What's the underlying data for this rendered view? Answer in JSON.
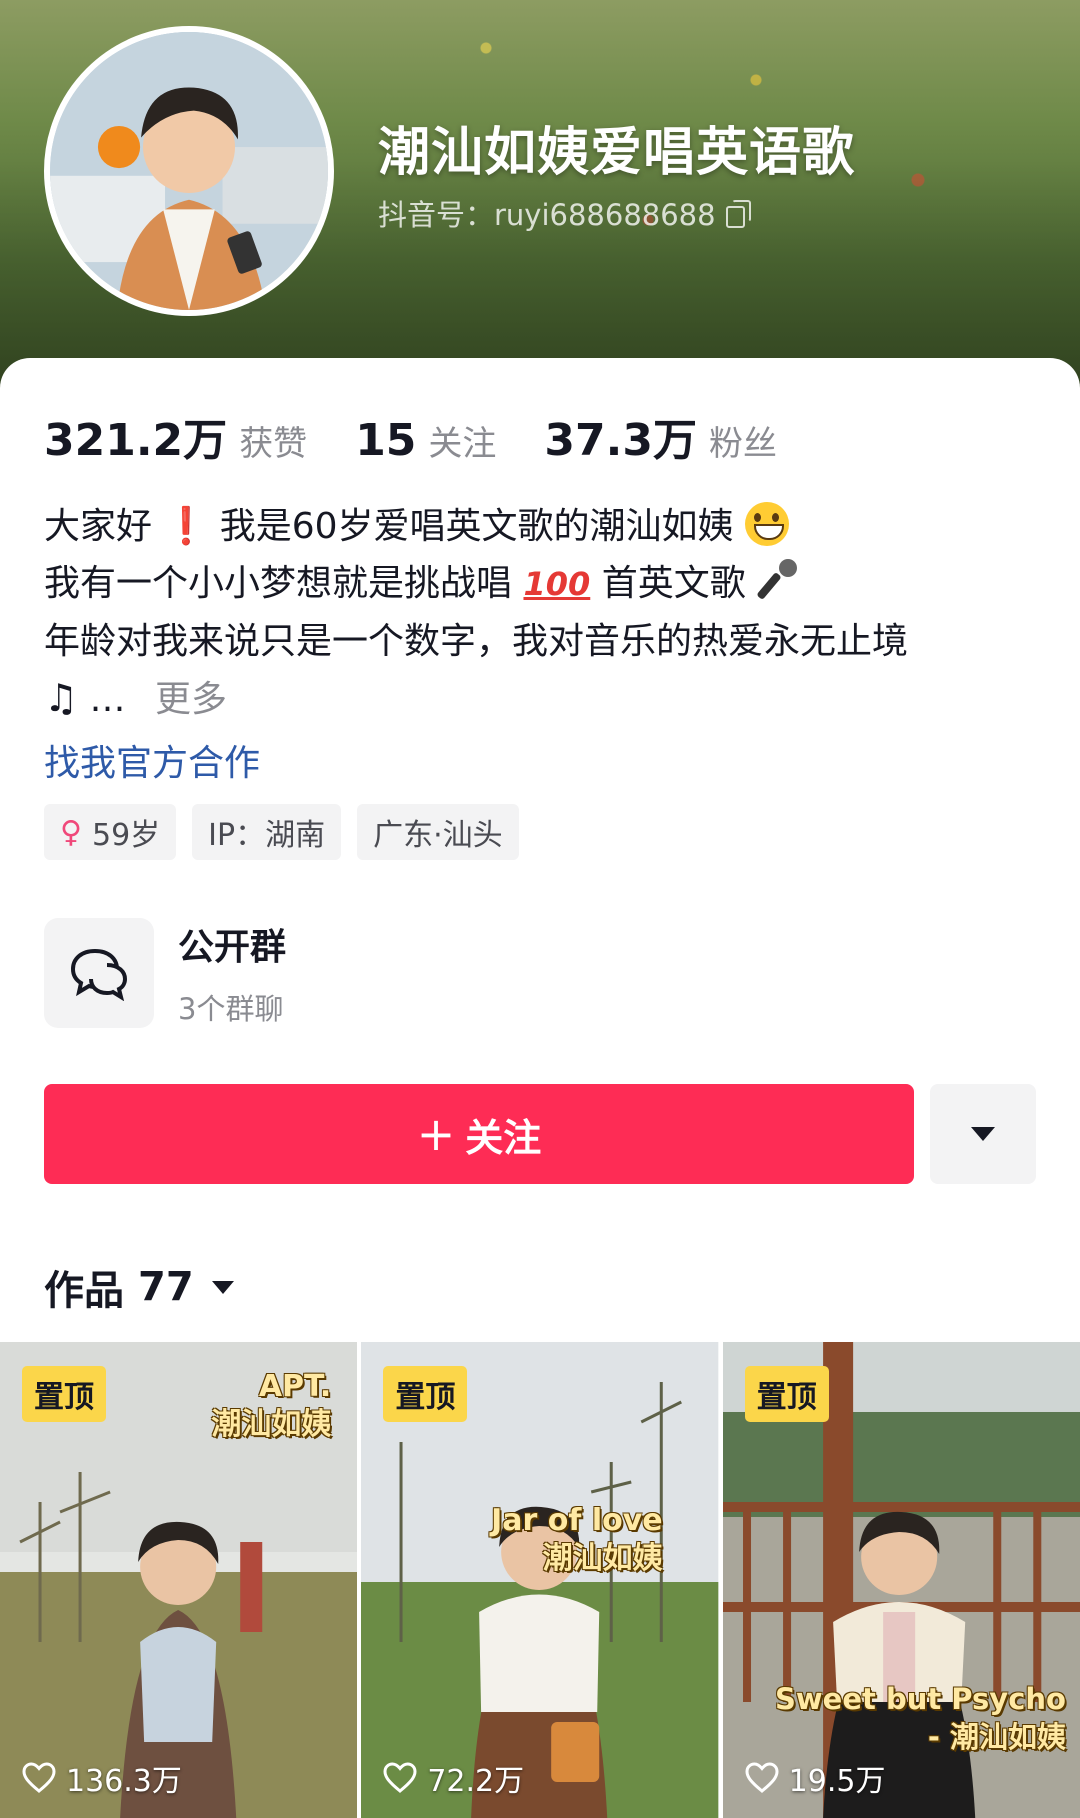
{
  "profile": {
    "name": "潮汕如姨爱唱英语歌",
    "douyin_id": "抖音号：ruyi688688688"
  },
  "stats": [
    {
      "value": "321.2万",
      "label": "获赞"
    },
    {
      "value": "15",
      "label": "关注"
    },
    {
      "value": "37.3万",
      "label": "粉丝"
    }
  ],
  "bio": {
    "line1_a": "大家好",
    "line1_b": "我是60岁爱唱英文歌的潮汕如姨",
    "line2_a": "我有一个小小梦想就是挑战唱",
    "line2_b": "100",
    "line2_c": "首英文歌",
    "line3": "年龄对我来说只是一个数字，我对音乐的热爱永无止境",
    "line4": "…",
    "more": "更多"
  },
  "cooperate_link": "找我官方合作",
  "tags": {
    "age": "59岁",
    "ip": "IP：湖南",
    "location": "广东·汕头"
  },
  "group": {
    "title": "公开群",
    "subtitle": "3个群聊"
  },
  "follow_button": "关注",
  "works": {
    "label": "作品",
    "count": "77"
  },
  "videos": [
    {
      "pin": "置顶",
      "caption_1": "APT.",
      "caption_2": "潮汕如姨",
      "likes": "136.3万"
    },
    {
      "pin": "置顶",
      "caption_1": "Jar of love",
      "caption_2": "潮汕如姨",
      "likes": "72.2万"
    },
    {
      "pin": "置顶",
      "caption_1": "Sweet but Psycho",
      "caption_2": "- 潮汕如姨",
      "likes": "19.5万"
    }
  ],
  "colors": {
    "follow": "#fe2c55",
    "link": "#2e5aa8",
    "pin": "#fbd64a"
  },
  "icons": [
    "copy-icon",
    "female-icon",
    "chat-group-icon",
    "caret-down-icon",
    "heart-icon",
    "smile-emoji-icon",
    "microphone-emoji-icon",
    "music-note-icon",
    "exclamation-emoji-icon"
  ]
}
